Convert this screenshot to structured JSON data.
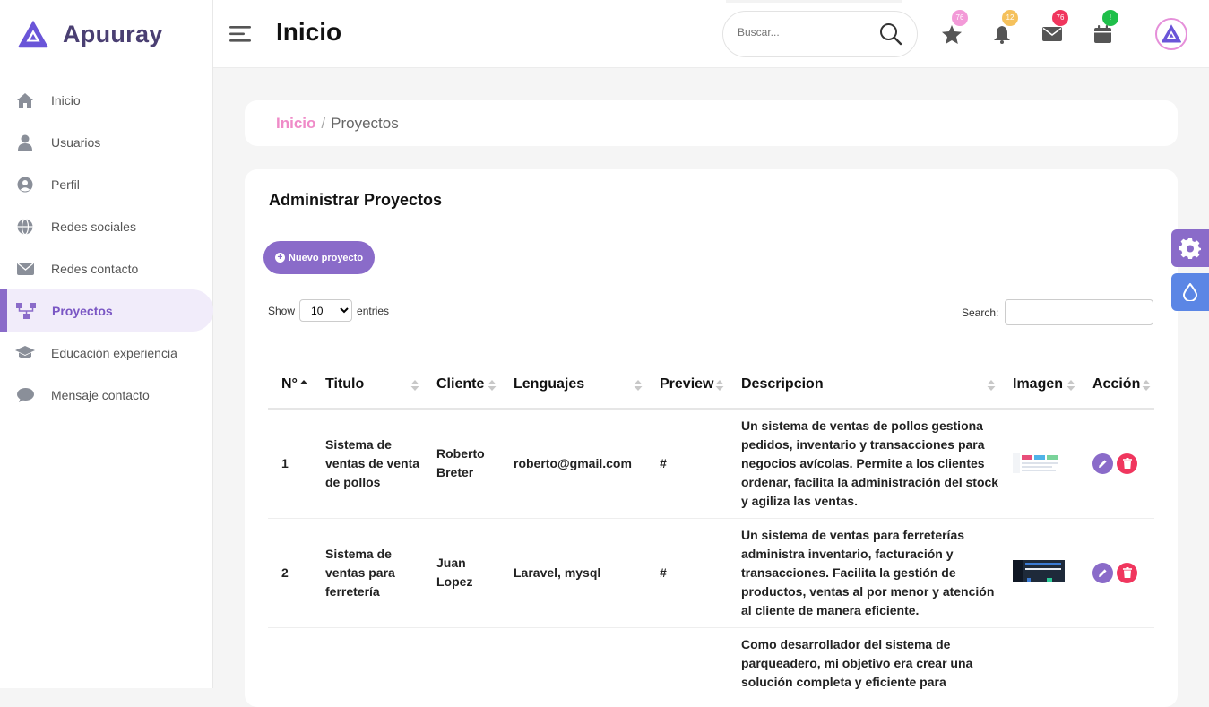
{
  "brand": {
    "name": "Apuuray"
  },
  "sidebar": {
    "items": [
      {
        "label": "Inicio",
        "icon": "home-icon"
      },
      {
        "label": "Usuarios",
        "icon": "user-icon"
      },
      {
        "label": "Perfil",
        "icon": "user-circle-icon"
      },
      {
        "label": "Redes sociales",
        "icon": "globe-icon"
      },
      {
        "label": "Redes contacto",
        "icon": "envelope-icon"
      },
      {
        "label": "Proyectos",
        "icon": "sitemap-icon",
        "active": true
      },
      {
        "label": "Educación experiencia",
        "icon": "graduation-cap-icon"
      },
      {
        "label": "Mensaje contacto",
        "icon": "comment-icon"
      }
    ]
  },
  "header": {
    "title": "Inicio",
    "search_placeholder": "Buscar...",
    "badges": {
      "favorites": "76",
      "notifications": "12",
      "messages": "76",
      "calendar": "!"
    }
  },
  "breadcrumb": {
    "home": "Inicio",
    "separator": "/",
    "current": "Proyectos"
  },
  "card": {
    "title": "Administrar Proyectos",
    "new_button": "Nuevo proyecto",
    "show_label": "Show",
    "entries_value": "10",
    "entries_label": "entries",
    "search_label": "Search:"
  },
  "table": {
    "columns": [
      "N°",
      "Titulo",
      "Cliente",
      "Lenguajes",
      "Preview",
      "Descripcion",
      "Imagen",
      "Acción"
    ],
    "rows": [
      {
        "n": "1",
        "titulo": "Sistema de ventas de venta de pollos",
        "cliente": "Roberto Breter",
        "lenguajes": "roberto@gmail.com",
        "preview": "#",
        "descripcion": "Un sistema de ventas de pollos gestiona pedidos, inventario y transacciones para negocios avícolas. Permite a los clientes ordenar, facilita la administración del stock y agiliza las ventas."
      },
      {
        "n": "2",
        "titulo": "Sistema de ventas para ferretería",
        "cliente": "Juan Lopez",
        "lenguajes": "Laravel, mysql",
        "preview": "#",
        "descripcion": "Un sistema de ventas para ferreterías administra inventario, facturación y transacciones. Facilita la gestión de productos, ventas al por menor y atención al cliente de manera eficiente."
      },
      {
        "n": "",
        "titulo": "",
        "cliente": "",
        "lenguajes": "",
        "preview": "",
        "descripcion": "Como desarrollador del sistema de parqueadero, mi objetivo era crear una solución completa y eficiente para"
      }
    ]
  },
  "colors": {
    "accent": "#8a6bc9",
    "pink": "#ef8bc8",
    "delete": "#f0365e",
    "float_settings": "#8a6bc9",
    "float_theme": "#5b86e5"
  }
}
